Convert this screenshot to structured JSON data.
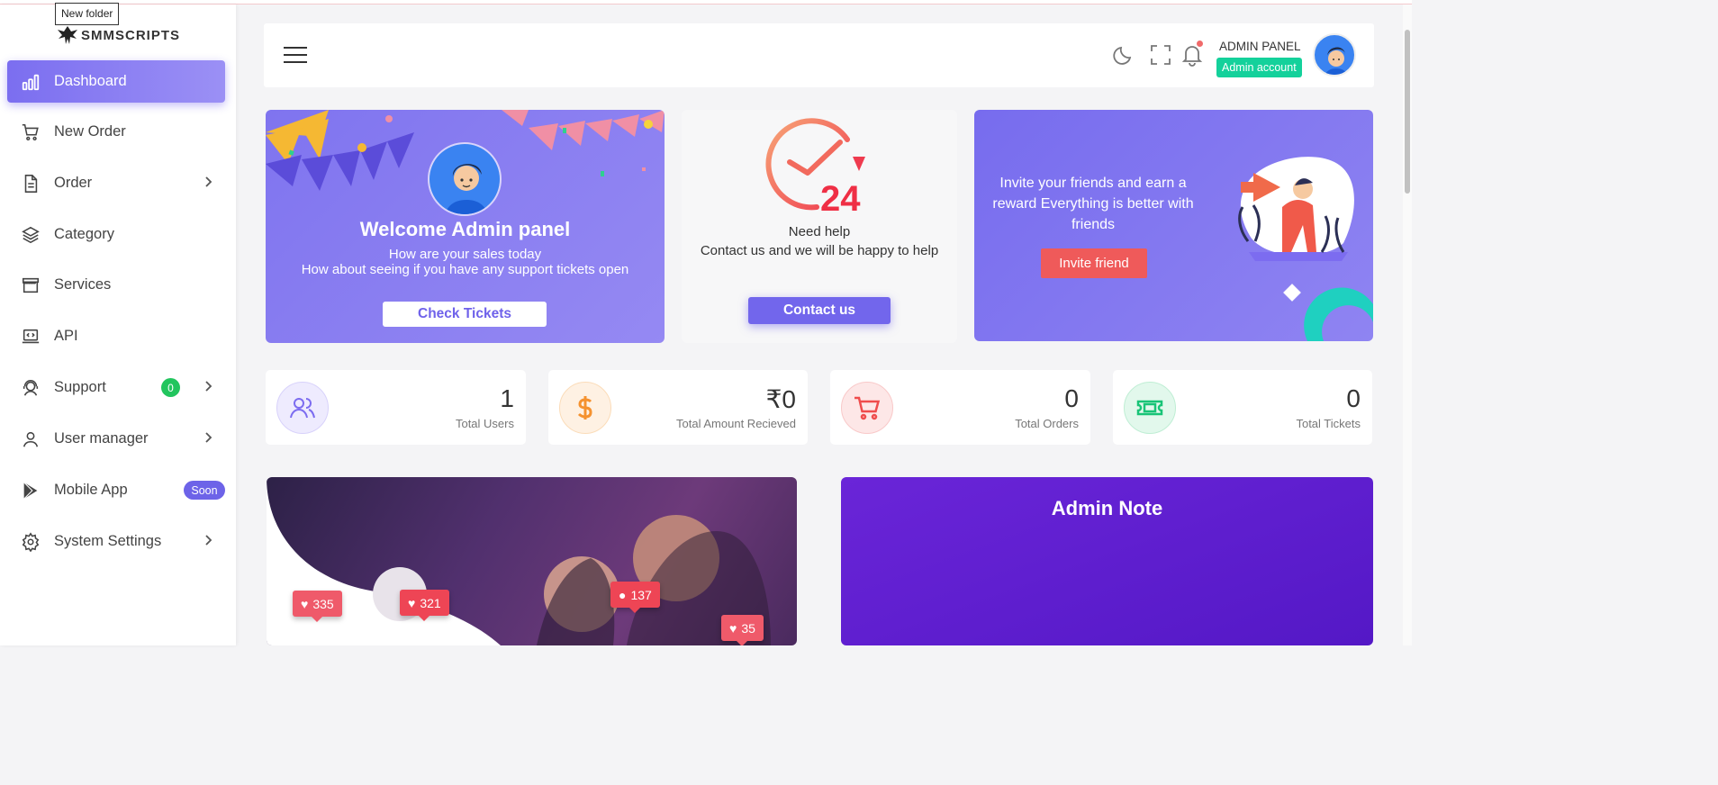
{
  "tooltip": "New folder",
  "brand": {
    "name": "SMMSCRIPTS"
  },
  "sidebar": {
    "items": [
      {
        "label": "Dashboard",
        "icon": "bar-chart-icon",
        "active": true
      },
      {
        "label": "New Order",
        "icon": "cart-icon"
      },
      {
        "label": "Order",
        "icon": "document-icon",
        "chevron": true
      },
      {
        "label": "Category",
        "icon": "layers-icon"
      },
      {
        "label": "Services",
        "icon": "store-icon"
      },
      {
        "label": "API",
        "icon": "laptop-code-icon"
      },
      {
        "label": "Support",
        "icon": "support-icon",
        "chevron": true,
        "badge": "0"
      },
      {
        "label": "User manager",
        "icon": "user-icon",
        "chevron": true
      },
      {
        "label": "Mobile App",
        "icon": "play-store-icon",
        "badge": "Soon"
      },
      {
        "label": "System Settings",
        "icon": "gear-icon",
        "chevron": true
      }
    ]
  },
  "header": {
    "admin_name": "ADMIN PANEL",
    "admin_role": "Admin account"
  },
  "welcome": {
    "title": "Welcome  Admin panel",
    "line1": "How are your sales today",
    "line2": "How about seeing if you have any support tickets open",
    "button": "Check Tickets"
  },
  "help": {
    "badge_text": "24",
    "line1": "Need help",
    "line2": "Contact us and we will be happy to help",
    "button": "Contact us"
  },
  "invite": {
    "text": "Invite your friends and earn a reward Everything is better with friends",
    "button": "Invite friend"
  },
  "stats": [
    {
      "value": "1",
      "label": "Total Users",
      "color": "#7c6cf0",
      "bg": "#eeebfe"
    },
    {
      "value": "₹0",
      "label": "Total Amount Recieved",
      "color": "#f5922f",
      "bg": "#fef1e3"
    },
    {
      "value": "0",
      "label": "Total Orders",
      "color": "#ef4d4d",
      "bg": "#fde7e7"
    },
    {
      "value": "0",
      "label": "Total Tickets",
      "color": "#18c477",
      "bg": "#e2f8ec"
    }
  ],
  "photo_badges": [
    {
      "value": "335",
      "icon": "heart-icon"
    },
    {
      "value": "321",
      "icon": "heart-icon"
    },
    {
      "value": "137",
      "icon": "person-icon"
    },
    {
      "value": "35",
      "icon": "heart-icon"
    }
  ],
  "admin_note": {
    "title": "Admin Note"
  },
  "colors": {
    "accent": "#7b6ef0",
    "note_bg": "#5e1fd0",
    "danger": "#ef5a5a",
    "success": "#14d19b"
  }
}
